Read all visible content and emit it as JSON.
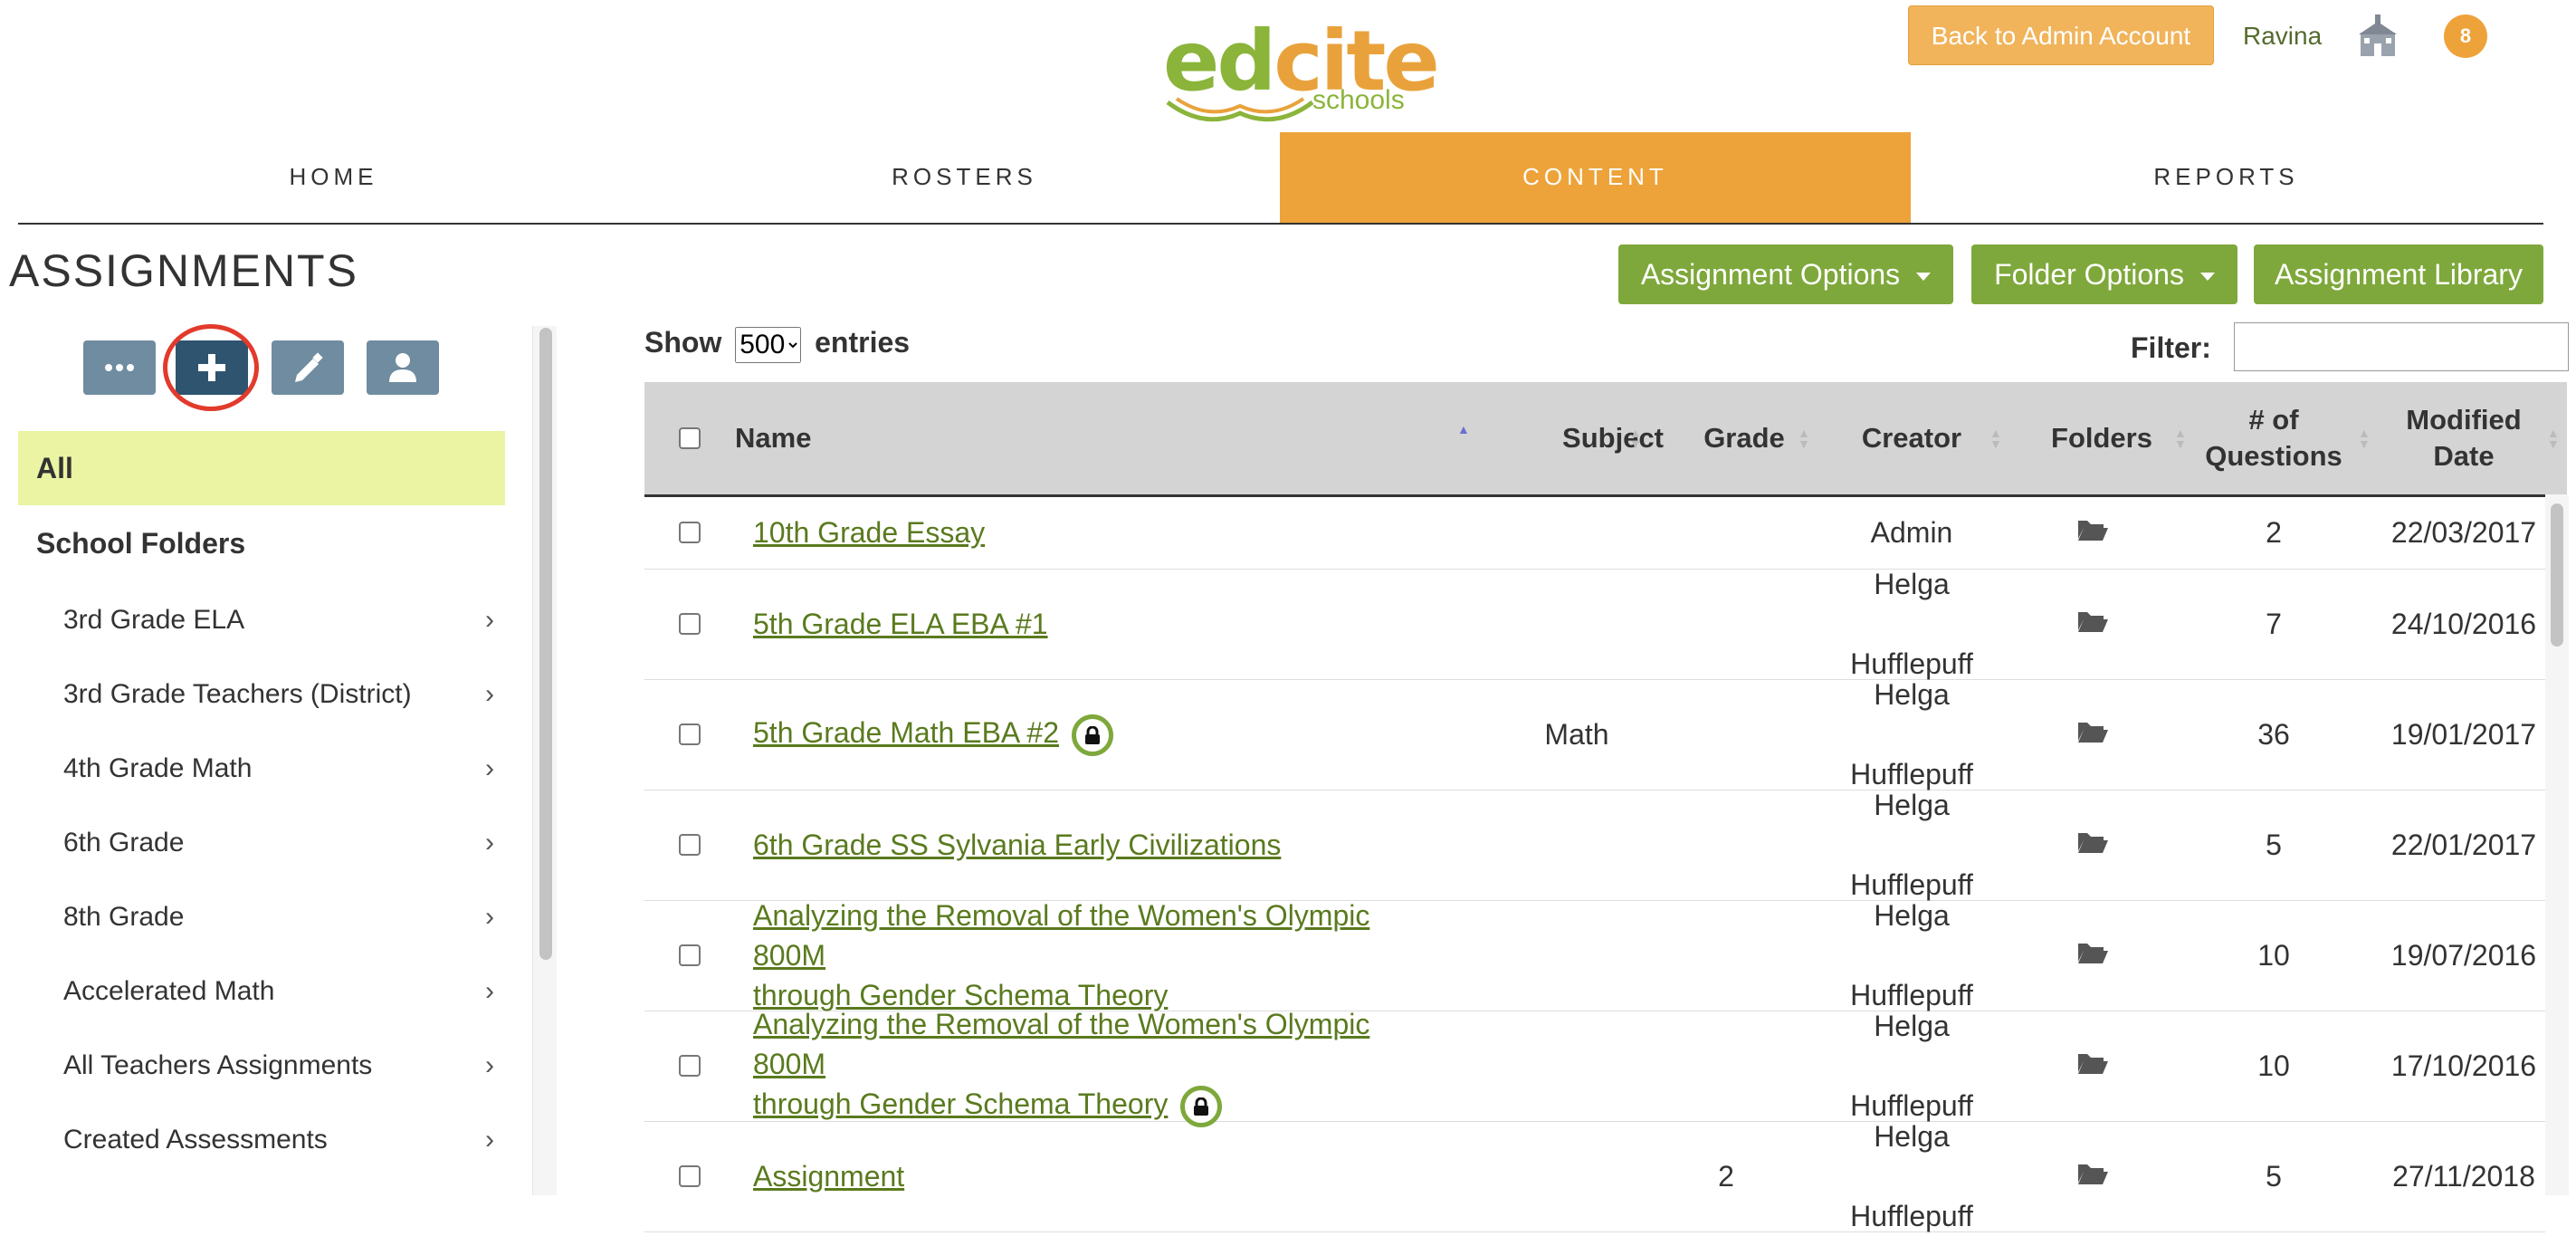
{
  "header": {
    "logo_word_a": "ed",
    "logo_word_b": "cite",
    "logo_sub": "schools",
    "admin_button": "Back to Admin Account",
    "user_name": "Ravina",
    "notification_count": "8"
  },
  "nav": {
    "tabs": [
      {
        "label": "HOME"
      },
      {
        "label": "ROSTERS"
      },
      {
        "label": "CONTENT"
      },
      {
        "label": "REPORTS"
      }
    ]
  },
  "page": {
    "title": "ASSIGNMENTS",
    "assignment_options": "Assignment Options",
    "folder_options": "Folder Options",
    "assignment_library": "Assignment Library"
  },
  "sidebar": {
    "tools": [
      "more-icon",
      "plus-icon",
      "pencil-icon",
      "user-icon"
    ],
    "all_label": "All",
    "section_label": "School Folders",
    "folders": [
      {
        "label": "3rd Grade ELA"
      },
      {
        "label": "3rd Grade Teachers (District)"
      },
      {
        "label": "4th Grade Math"
      },
      {
        "label": "6th Grade"
      },
      {
        "label": "8th Grade"
      },
      {
        "label": "Accelerated Math"
      },
      {
        "label": "All Teachers Assignments"
      },
      {
        "label": "Created Assessments"
      }
    ]
  },
  "table": {
    "show_label": "Show",
    "entries_value": "500",
    "entries_label": "entries",
    "filter_label": "Filter:",
    "filter_value": "",
    "headers": {
      "name": "Name",
      "subject": "Subject",
      "grade": "Grade",
      "creator": "Creator",
      "folders": "Folders",
      "questions_1": "# of",
      "questions_2": "Questions",
      "modified_1": "Modified",
      "modified_2": "Date"
    },
    "rows": [
      {
        "name_1": "10th Grade Essay",
        "name_2": "",
        "locked": false,
        "subject": "",
        "grade": "",
        "creator_1": "Admin",
        "creator_2": "",
        "questions": "2",
        "date": "22/03/2017"
      },
      {
        "name_1": "5th Grade ELA EBA #1",
        "name_2": "",
        "locked": false,
        "subject": "",
        "grade": "",
        "creator_1": "Helga",
        "creator_2": "Hufflepuff",
        "questions": "7",
        "date": "24/10/2016"
      },
      {
        "name_1": "5th Grade Math EBA #2",
        "name_2": "",
        "locked": true,
        "subject": "Math",
        "grade": "",
        "creator_1": "Helga",
        "creator_2": "Hufflepuff",
        "questions": "36",
        "date": "19/01/2017"
      },
      {
        "name_1": "6th Grade SS Sylvania Early Civilizations",
        "name_2": "",
        "locked": false,
        "subject": "",
        "grade": "",
        "creator_1": "Helga",
        "creator_2": "Hufflepuff",
        "questions": "5",
        "date": "22/01/2017"
      },
      {
        "name_1": "Analyzing the Removal of the Women's Olympic 800M",
        "name_2": "through Gender Schema Theory",
        "locked": false,
        "subject": "",
        "grade": "",
        "creator_1": "Helga",
        "creator_2": "Hufflepuff",
        "questions": "10",
        "date": "19/07/2016"
      },
      {
        "name_1": "Analyzing the Removal of the Women's Olympic 800M",
        "name_2": "through Gender Schema Theory",
        "locked": true,
        "subject": "",
        "grade": "",
        "creator_1": "Helga",
        "creator_2": "Hufflepuff",
        "questions": "10",
        "date": "17/10/2016"
      },
      {
        "name_1": "Assignment",
        "name_2": "",
        "locked": false,
        "subject": "",
        "grade": "2",
        "creator_1": "Helga",
        "creator_2": "Hufflepuff",
        "questions": "5",
        "date": "27/11/2018"
      }
    ]
  },
  "colors": {
    "brand_green": "#7ea83b",
    "brand_orange": "#eda33a",
    "link_green": "#5a7a1e",
    "highlight": "#eaf4a3",
    "annotation_red": "#e23a2c"
  }
}
